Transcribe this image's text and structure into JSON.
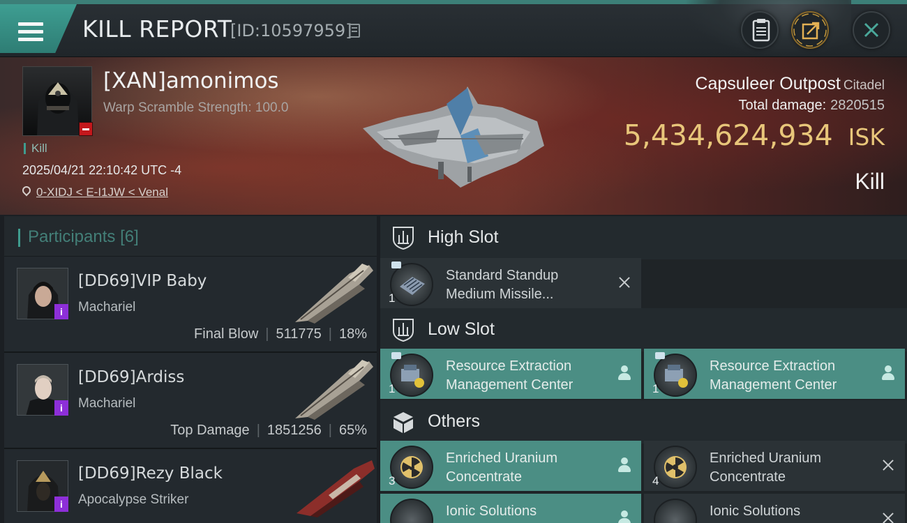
{
  "header": {
    "title": "KILL REPORT",
    "report_id": "[ID:10597959]",
    "icons": [
      "menu-icon",
      "copy-icon",
      "clipboard-icon",
      "share-icon",
      "close-icon"
    ]
  },
  "victim": {
    "name": "[XAN]amonimos",
    "detail": "Warp Scramble Strength: 100.0",
    "standing_badge": "minus",
    "tag": "Kill",
    "datetime": "2025/04/21 22:10:42 UTC -4",
    "location": "0-XIDJ < E-I1JW < Venal"
  },
  "target": {
    "name": "Capsuleer Outpost",
    "class": "Citadel",
    "total_damage_label": "Total damage:",
    "total_damage": "2820515",
    "isk_value": "5,434,624,934",
    "isk_unit": "ISK",
    "result": "Kill"
  },
  "participants": {
    "title": "Participants",
    "count": "[6]",
    "items": [
      {
        "name": "[DD69]VIP Baby",
        "ship": "Machariel",
        "role": "Final Blow",
        "damage": "511775",
        "percent": "18%"
      },
      {
        "name": "[DD69]Ardiss",
        "ship": "Machariel",
        "role": "Top Damage",
        "damage": "1851256",
        "percent": "65%"
      },
      {
        "name": "[DD69]Rezy Black",
        "ship": "Apocalypse Striker",
        "role": "",
        "damage": "",
        "percent": ""
      }
    ]
  },
  "slots": {
    "high": {
      "label": "High Slot",
      "modules": [
        {
          "name_l1": "Standard Standup",
          "name_l2": "Medium Missile...",
          "qty": "1",
          "status": "destroyed"
        }
      ]
    },
    "low": {
      "label": "Low Slot",
      "modules": [
        {
          "name_l1": "Resource Extraction",
          "name_l2": "Management Center",
          "qty": "1",
          "status": "dropped"
        },
        {
          "name_l1": "Resource Extraction",
          "name_l2": "Management Center",
          "qty": "1",
          "status": "dropped"
        }
      ]
    },
    "others": {
      "label": "Others",
      "modules": [
        {
          "name_l1": "Enriched Uranium",
          "name_l2": "Concentrate",
          "qty": "3",
          "status": "dropped"
        },
        {
          "name_l1": "Enriched Uranium",
          "name_l2": "Concentrate",
          "qty": "4",
          "status": "destroyed"
        },
        {
          "name_l1": "Ionic Solutions",
          "name_l2": "",
          "qty": "",
          "status": "dropped"
        },
        {
          "name_l1": "Ionic Solutions",
          "name_l2": "",
          "qty": "",
          "status": "destroyed"
        }
      ]
    }
  },
  "colors": {
    "accent": "#3f9c8e",
    "isk": "#e8c67a",
    "fitted_bg": "#4b8e84",
    "badge_purple": "#8d2fd8",
    "badge_red": "#c4181c"
  }
}
